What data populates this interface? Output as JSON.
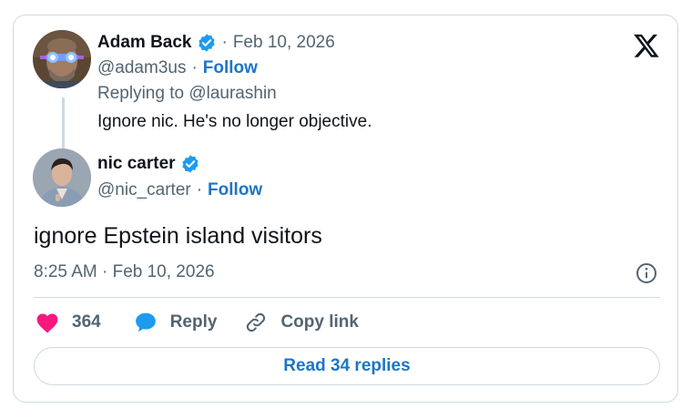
{
  "quoted_tweet": {
    "author_name": "Adam Back",
    "separator": "·",
    "date": "Feb 10, 2026",
    "handle": "@adam3us",
    "follow_label": "Follow",
    "replying_to": "Replying to @laurashin",
    "text": "Ignore nic. He's no longer objective.",
    "avatar_icon": "avatar-glowing-eyes",
    "verified_icon": "verified-badge-icon"
  },
  "main_tweet": {
    "author_name": "nic carter",
    "handle": "@nic_carter",
    "separator": "·",
    "follow_label": "Follow",
    "text": "ignore Epstein island visitors",
    "timestamp": "8:25 AM · Feb 10, 2026",
    "avatar_icon": "avatar-photo",
    "verified_icon": "verified-badge-icon"
  },
  "actions": {
    "likes_count": "364",
    "reply_label": "Reply",
    "copy_link_label": "Copy link",
    "like_icon": "heart-icon",
    "reply_icon": "speech-bubble-icon",
    "copy_icon": "link-icon"
  },
  "read_replies_label": "Read 34 replies",
  "brand_icon": "x-logo-icon",
  "info_icon": "info-icon",
  "colors": {
    "verified": "#1d9bf0",
    "link": "#1d75c7",
    "heart": "#f91880",
    "muted": "#536471",
    "border": "#cfd9de"
  }
}
